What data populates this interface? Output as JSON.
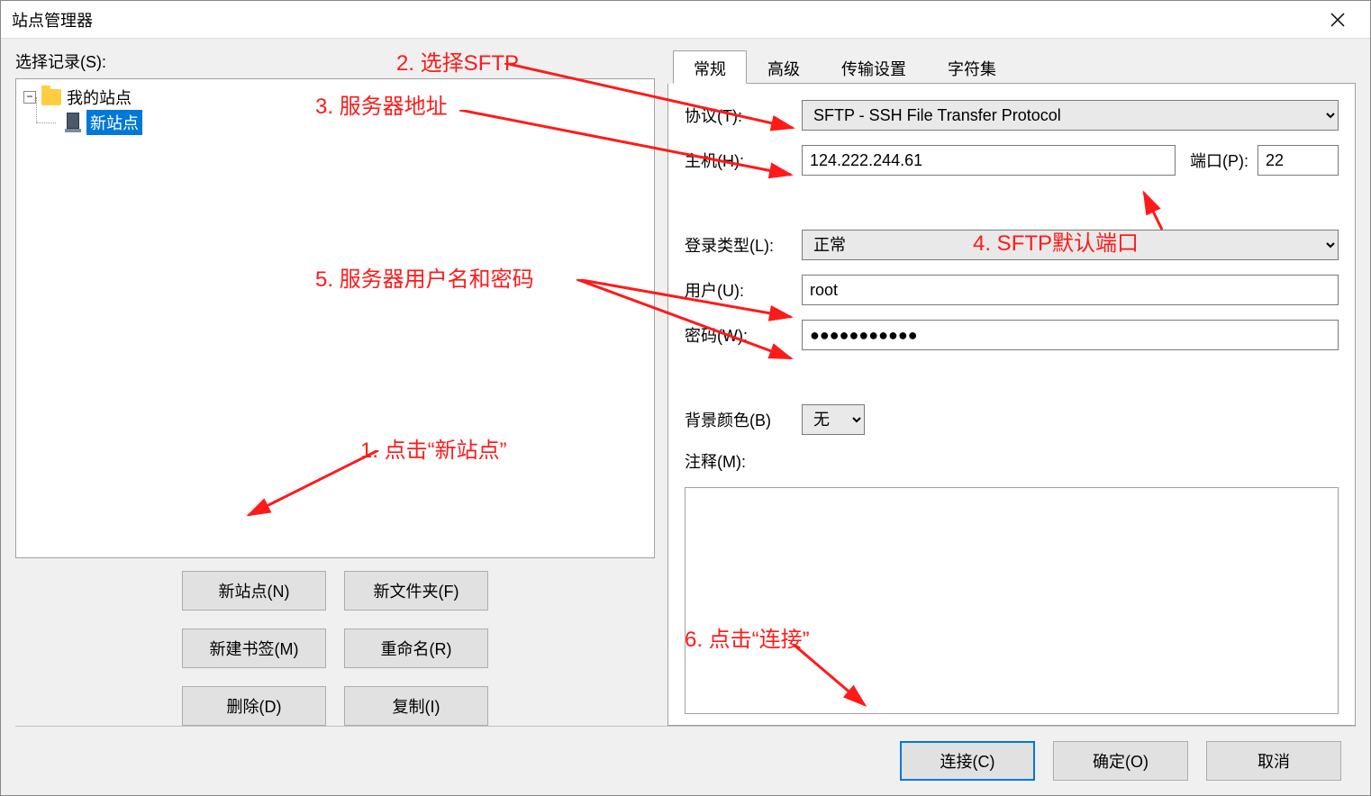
{
  "titlebar": {
    "title": "站点管理器"
  },
  "left": {
    "select_label": "选择记录(S):",
    "root_node": "我的站点",
    "child_node": "新站点",
    "buttons": {
      "new_site": "新站点(N)",
      "new_folder": "新文件夹(F)",
      "new_bookmark": "新建书签(M)",
      "rename": "重命名(R)",
      "delete": "删除(D)",
      "copy": "复制(I)"
    }
  },
  "tabs": {
    "general": "常规",
    "advanced": "高级",
    "transfer": "传输设置",
    "charset": "字符集"
  },
  "form": {
    "protocol_label": "协议(T):",
    "protocol_value": "SFTP - SSH File Transfer Protocol",
    "host_label": "主机(H):",
    "host_value": "124.222.244.61",
    "port_label": "端口(P):",
    "port_value": "22",
    "login_type_label": "登录类型(L):",
    "login_type_value": "正常",
    "user_label": "用户(U):",
    "user_value": "root",
    "pass_label": "密码(W):",
    "pass_value": "●●●●●●●●●●●",
    "bg_label": "背景颜色(B)",
    "bg_value": "无",
    "notes_label": "注释(M):"
  },
  "footer": {
    "connect": "连接(C)",
    "ok": "确定(O)",
    "cancel": "取消"
  },
  "annotations": {
    "a1": "1. 点击“新站点”",
    "a2": "2. 选择SFTP",
    "a3": "3. 服务器地址",
    "a4": "4. SFTP默认端口",
    "a5": "5. 服务器用户名和密码",
    "a6": "6. 点击“连接”"
  }
}
